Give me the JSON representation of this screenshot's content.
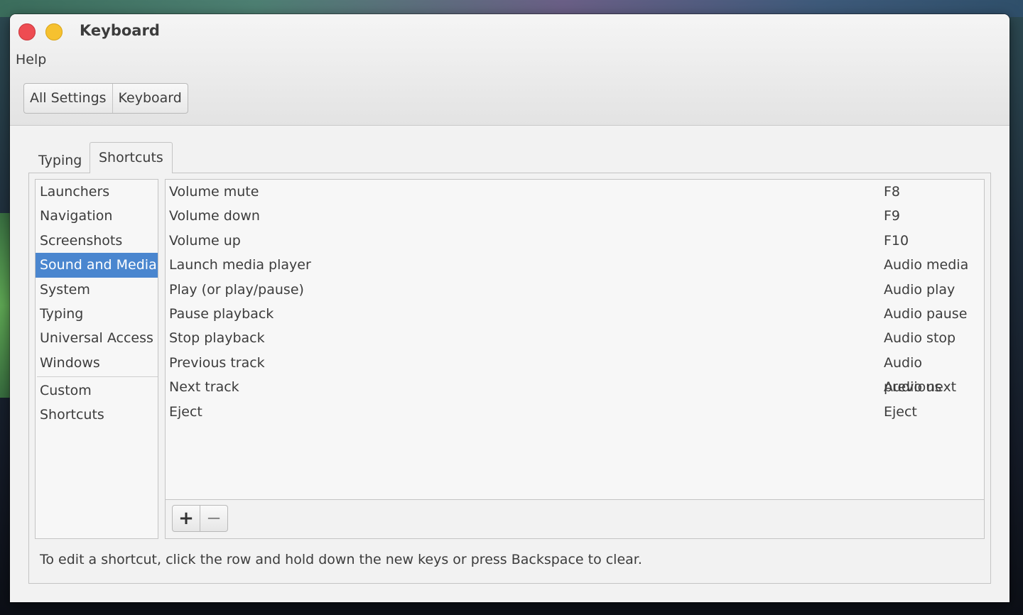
{
  "window": {
    "title": "Keyboard"
  },
  "menu": {
    "help": "Help"
  },
  "breadcrumbs": [
    "All Settings",
    "Keyboard"
  ],
  "tabs": {
    "typing": "Typing",
    "shortcuts": "Shortcuts",
    "active": "Shortcuts"
  },
  "categories": {
    "items": [
      "Launchers",
      "Navigation",
      "Screenshots",
      "Sound and Media",
      "System",
      "Typing",
      "Universal Access",
      "Windows"
    ],
    "selected": "Sound and Media",
    "custom": "Custom Shortcuts"
  },
  "shortcuts": [
    {
      "action": "Volume mute",
      "key": "F8"
    },
    {
      "action": "Volume down",
      "key": "F9"
    },
    {
      "action": "Volume up",
      "key": "F10"
    },
    {
      "action": "Launch media player",
      "key": "Audio media"
    },
    {
      "action": "Play (or play/pause)",
      "key": "Audio play"
    },
    {
      "action": "Pause playback",
      "key": "Audio pause"
    },
    {
      "action": "Stop playback",
      "key": "Audio stop"
    },
    {
      "action": "Previous track",
      "key": "Audio previous"
    },
    {
      "action": "Next track",
      "key": "Audio next"
    },
    {
      "action": "Eject",
      "key": "Eject"
    }
  ],
  "toolbar": {
    "add_glyph": "+",
    "remove_glyph": "−"
  },
  "hint": "To edit a shortcut, click the row and hold down the new keys or press Backspace to clear.",
  "colors": {
    "selection": "#4a86cf",
    "close": "#ee4c52",
    "minimize": "#f6c12f"
  }
}
